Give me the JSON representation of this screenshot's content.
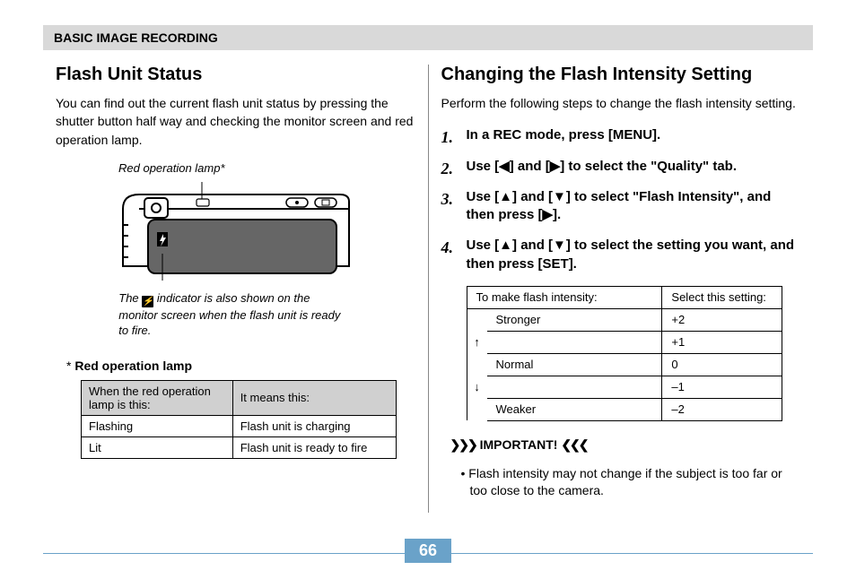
{
  "section_header": "BASIC IMAGE RECORDING",
  "left": {
    "title": "Flash Unit Status",
    "body": "You can find out the current flash unit status by pressing the shutter button half way and checking the monitor screen and red operation lamp.",
    "diagram_label": "Red operation lamp*",
    "caption_pre": "The",
    "caption_post": "indicator is also shown on the monitor screen when the flash unit is ready to fire.",
    "lamp_heading": "Red operation lamp",
    "table": {
      "h1": "When the red operation lamp is this:",
      "h2": "It means this:",
      "rows": [
        [
          "Flashing",
          "Flash unit is charging"
        ],
        [
          "Lit",
          "Flash unit is ready to fire"
        ]
      ]
    }
  },
  "right": {
    "title": "Changing the Flash Intensity Setting",
    "body": "Perform the following steps to change the flash intensity setting.",
    "steps": [
      "In a REC mode, press [MENU].",
      "Use [◀] and [▶] to select the \"Quality\" tab.",
      "Use [▲] and [▼] to select \"Flash Intensity\", and then press [▶].",
      "Use [▲] and [▼] to select the setting you want, and then press [SET]."
    ],
    "table": {
      "h1": "To make flash intensity:",
      "h2": "Select this setting:",
      "rows": [
        {
          "label": "Stronger",
          "arrow": "",
          "value": "+2"
        },
        {
          "label": "",
          "arrow": "↑",
          "value": "+1"
        },
        {
          "label": "Normal",
          "arrow": "",
          "value": " 0"
        },
        {
          "label": "",
          "arrow": "↓",
          "value": "–1"
        },
        {
          "label": "Weaker",
          "arrow": "",
          "value": "–2"
        }
      ]
    },
    "important_label": "IMPORTANT!",
    "important_bullet": "Flash intensity may not change if the subject is too far or too close to the camera."
  },
  "page_number": "66"
}
